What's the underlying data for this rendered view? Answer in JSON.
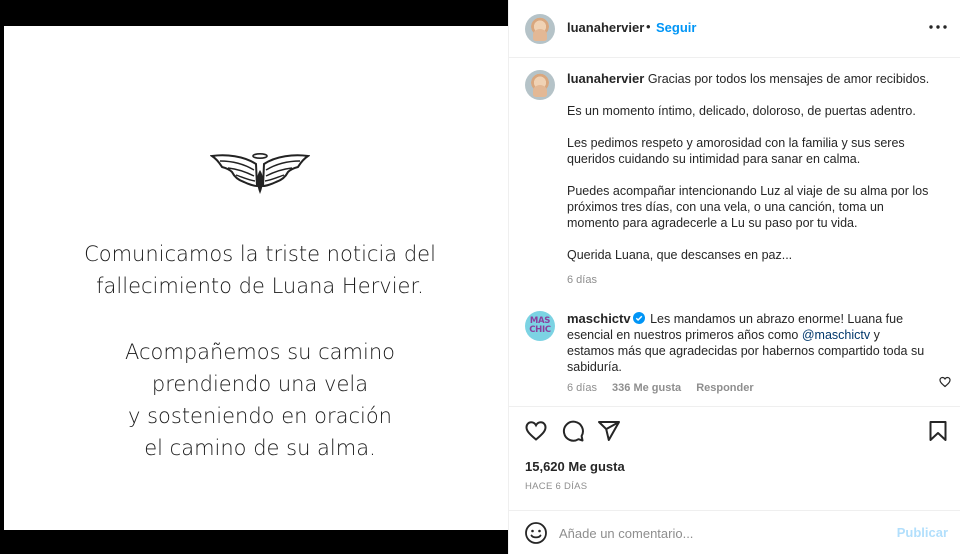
{
  "post": {
    "headline_lines": [
      "Comunicamos la triste noticia del",
      "fallecimiento de Luana Hervier."
    ],
    "prayer_lines": [
      "Acompañemos su camino",
      "prendiendo una vela",
      "y sosteniendo en oración",
      "el camino de su alma."
    ]
  },
  "header": {
    "username": "luanahervier",
    "separator": "•",
    "follow_label": "Seguir",
    "more_icon": "more-options-icon"
  },
  "caption": {
    "username": "luanahervier",
    "paragraphs": [
      "Gracias por todos los mensajes de amor recibidos.",
      "Es un momento íntimo, delicado, doloroso, de puertas adentro.",
      "Les pedimos respeto y amorosidad con la familia y sus seres queridos cuidando su intimidad para sanar en calma.",
      "Puedes acompañar intencionando Luz al viaje de su alma por los próximos tres días, con una vela, o una canción, toma un momento para agradecerle a Lu su paso por tu vida.",
      "Querida Luana, que descanses en paz..."
    ],
    "time": "6 días"
  },
  "comment": {
    "username": "maschictv",
    "avatar_text": [
      "MAS",
      "CHIC"
    ],
    "text_before": "Les mandamos un abrazo enorme! Luana fue esencial en nuestros primeros años como ",
    "mention": "@maschictv",
    "text_after": " y estamos más que agradecidas por habernos compartido toda su sabiduría.",
    "time": "6 días",
    "likes": "336 Me gusta",
    "reply_label": "Responder"
  },
  "actions": {
    "like_count": "15,620 Me gusta",
    "date_ago": "HACE 6 DÍAS"
  },
  "composer": {
    "placeholder": "Añade un comentario...",
    "publish_label": "Publicar"
  },
  "colors": {
    "accent": "#0095f6",
    "publish_disabled": "#b2dffc",
    "secondary_text": "#8e8e8e",
    "mention": "#00376b"
  }
}
